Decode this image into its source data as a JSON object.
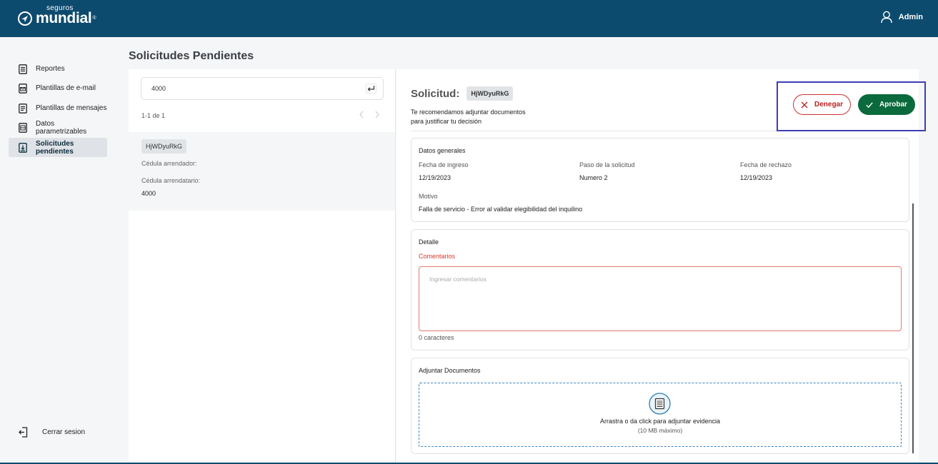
{
  "brand": {
    "small": "seguros",
    "big": "mundial",
    "mark": "®"
  },
  "user": {
    "name": "Admin"
  },
  "sidebar": {
    "items": [
      {
        "label": "Reportes"
      },
      {
        "label": "Plantillas de e-mail"
      },
      {
        "label": "Plantillas de mensajes"
      },
      {
        "label": "Datos parametrizables"
      },
      {
        "label": "Solicitudes pendientes",
        "active": true
      }
    ],
    "logout": "Cerrar sesion"
  },
  "page": {
    "title": "Solicitudes Pendientes"
  },
  "list": {
    "search_value": "4000",
    "pagination": "1-1 de 1",
    "items": [
      {
        "id": "HjWDyuRkG",
        "landlord_label": "Cédula arrendador:",
        "tenant_label": "Cédula arrendatario:",
        "tenant_value": "4000"
      }
    ]
  },
  "detail": {
    "title": "Solicitud:",
    "id": "HjWDyuRkG",
    "hint_line1": "Te recomendamos adjuntar documentos",
    "hint_line2": "para justificar tu decisión",
    "deny_label": "Denegar",
    "approve_label": "Aprobar",
    "general": {
      "title": "Datos generales",
      "fecha_ingreso_label": "Fecha de ingreso",
      "fecha_ingreso": "12/19/2023",
      "paso_label": "Paso de la solicitud",
      "paso": "Numero 2",
      "fecha_rechazo_label": "Fecha de rechazo",
      "fecha_rechazo": "12/19/2023",
      "motivo_label": "Motivo",
      "motivo": "Falla de servicio - Error al validar elegibilidad del inquilino"
    },
    "detalle": {
      "title": "Detalle",
      "comments_label": "Comentarios",
      "comments_placeholder": "Ingresar comentarios",
      "char_count": "0 caracteres"
    },
    "docs": {
      "title": "Adjuntar Documentos",
      "drop_text": "Arrastra o da click para adjuntar evidencia",
      "drop_sub": "(10 MB máximo)"
    }
  },
  "colors": {
    "header": "#0d4b6e",
    "approve": "#0b6a3d",
    "deny": "#c33333",
    "highlight": "#3e3eb3"
  }
}
